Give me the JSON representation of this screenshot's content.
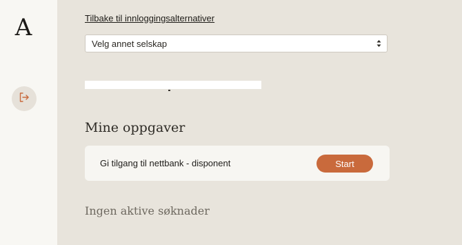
{
  "sidebar": {
    "logo_text": "A",
    "logout_icon": "logout-icon"
  },
  "main": {
    "back_link": "Tilbake til innloggingsalternativer",
    "company_select": {
      "selected": "Velg annet selskap"
    },
    "tasks_title": "Mine oppgaver",
    "task": {
      "label": "Gi tilgang til nettbank - disponent",
      "button": "Start"
    },
    "empty_title": "Ingen aktive søknader"
  },
  "colors": {
    "background": "#e8e4dc",
    "sidebar": "#f8f7f3",
    "accent": "#c96a3c"
  }
}
